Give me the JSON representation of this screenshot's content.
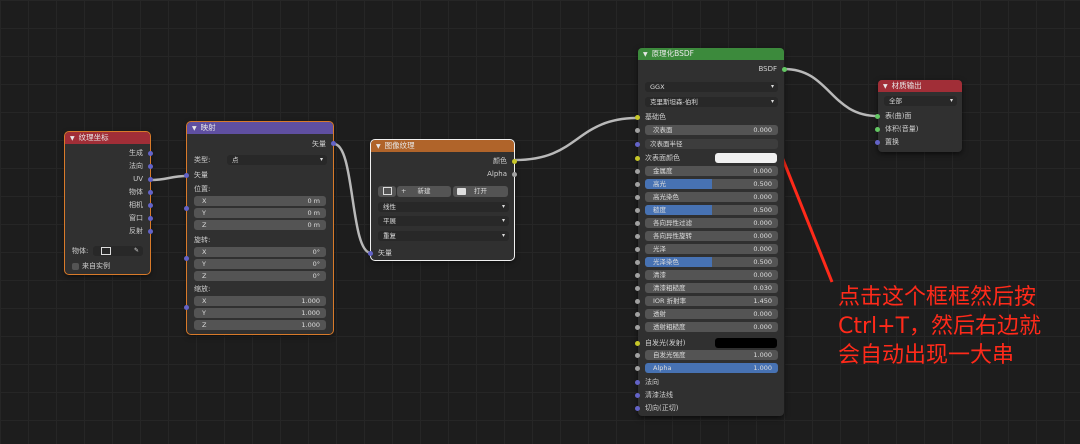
{
  "colors": {
    "texcoord_header": "#a12e37",
    "vector_header": "#5f4fa1",
    "texture_header": "#b0642a",
    "shader_header": "#3c8a3c",
    "output_header": "#a12e37",
    "vector_socket": "#6363c7",
    "color_socket": "#c7c729",
    "float_socket": "#a1a1a1",
    "shader_socket": "#63c763",
    "selection": "#d87a2a",
    "field_fill": "#4772b3",
    "annotation": "#ff2a1a"
  },
  "texcoord": {
    "title": "纹理坐标",
    "outputs": [
      "生成",
      "法向",
      "UV",
      "物体",
      "相机",
      "窗口",
      "反射"
    ],
    "object_label": "物体:",
    "from_instancer": "来自实例"
  },
  "mapping": {
    "title": "映射",
    "output": "矢量",
    "type_label": "类型:",
    "type_value": "点",
    "vector_input": "矢量",
    "location_label": "位置:",
    "loc": [
      {
        "axis": "X",
        "value": "0 m"
      },
      {
        "axis": "Y",
        "value": "0 m"
      },
      {
        "axis": "Z",
        "value": "0 m"
      }
    ],
    "rotation_label": "旋转:",
    "rot": [
      {
        "axis": "X",
        "value": "0°"
      },
      {
        "axis": "Y",
        "value": "0°"
      },
      {
        "axis": "Z",
        "value": "0°"
      }
    ],
    "scale_label": "缩放:",
    "scale": [
      {
        "axis": "X",
        "value": "1.000"
      },
      {
        "axis": "Y",
        "value": "1.000"
      },
      {
        "axis": "Z",
        "value": "1.000"
      }
    ]
  },
  "image_texture": {
    "title": "图像纹理",
    "outputs": [
      "颜色",
      "Alpha"
    ],
    "new_label": "新建",
    "open_label": "打开",
    "interpolation": "线性",
    "projection": "平展",
    "extension": "重复",
    "vector_input": "矢量"
  },
  "bsdf": {
    "title": "原理化BSDF",
    "output": "BSDF",
    "distribution": "GGX",
    "subsurface_method": "克里斯坦森-伯利",
    "base_color": "基础色",
    "subsurface": {
      "label": "次表面",
      "value": "0.000"
    },
    "subsurface_radius": "次表面半径",
    "subsurface_color": "次表面颜色",
    "fields": [
      {
        "label": "金属度",
        "value": "0.000",
        "fill": 0
      },
      {
        "label": "高光",
        "value": "0.500",
        "fill": 0.5
      },
      {
        "label": "高光染色",
        "value": "0.000",
        "fill": 0
      },
      {
        "label": "糙度",
        "value": "0.500",
        "fill": 0.5
      },
      {
        "label": "各向异性过滤",
        "value": "0.000",
        "fill": 0
      },
      {
        "label": "各向异性旋转",
        "value": "0.000",
        "fill": 0
      },
      {
        "label": "光泽",
        "value": "0.000",
        "fill": 0
      },
      {
        "label": "光泽染色",
        "value": "0.500",
        "fill": 0.5
      },
      {
        "label": "清漆",
        "value": "0.000",
        "fill": 0
      },
      {
        "label": "清漆粗糙度",
        "value": "0.030",
        "fill": 0.03
      },
      {
        "label": "IOR 折射率",
        "value": "1.450",
        "fill": 0
      },
      {
        "label": "透射",
        "value": "0.000",
        "fill": 0
      },
      {
        "label": "透射粗糙度",
        "value": "0.000",
        "fill": 0
      }
    ],
    "emission": "自发光(发射)",
    "emission_strength": {
      "label": "自发光强度",
      "value": "1.000"
    },
    "alpha": {
      "label": "Alpha",
      "value": "1.000"
    },
    "normal": "法向",
    "clearcoat_normal": "清漆法线",
    "tangent": "切向(正切)"
  },
  "material_output": {
    "title": "材质输出",
    "target": "全部",
    "inputs": [
      "表(曲)面",
      "体积(音量)",
      "置换"
    ]
  },
  "annotation": {
    "lines": [
      "点击这个框框然后按",
      "Ctrl+T，然后右边就",
      "会自动出现一大串"
    ]
  }
}
